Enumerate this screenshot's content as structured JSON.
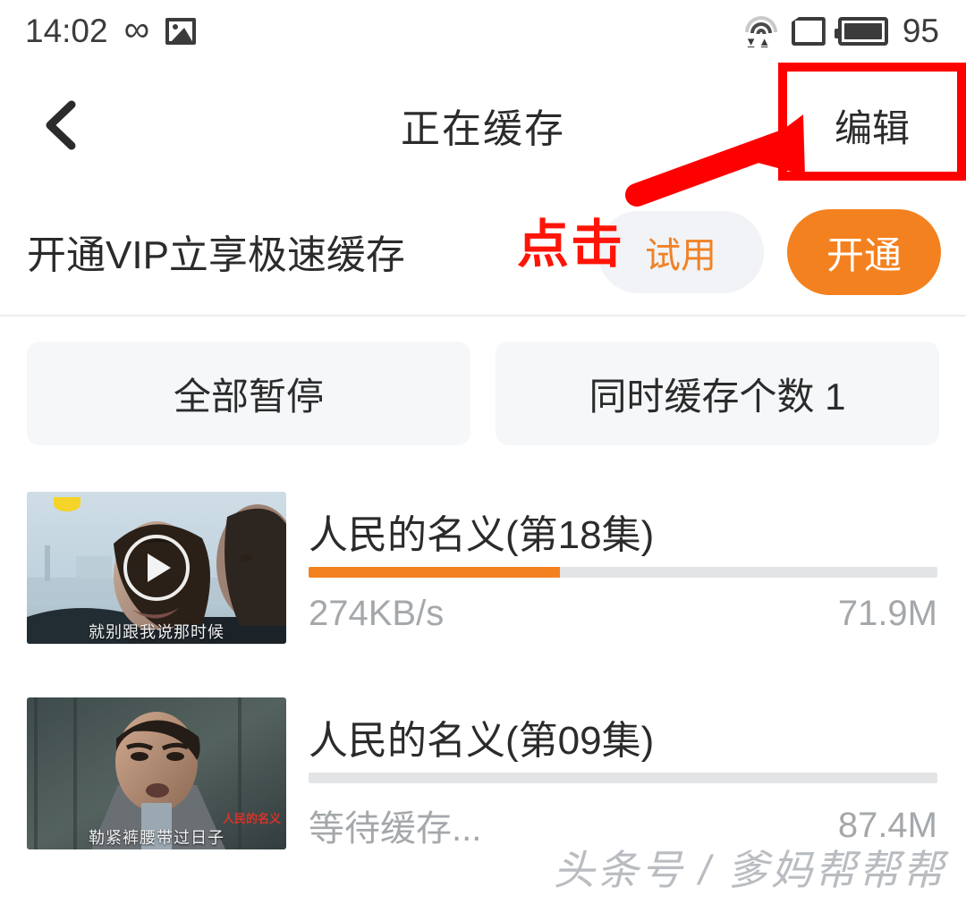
{
  "status_bar": {
    "time": "14:02",
    "infinity_glyph": "∞",
    "icons": [
      "infinity-icon",
      "image-icon",
      "wifi-icon",
      "sim-card-icon",
      "battery-icon"
    ],
    "battery_level": "95"
  },
  "nav": {
    "back_icon": "back-chevron-icon",
    "title": "正在缓存",
    "edit_label": "编辑"
  },
  "vip": {
    "text": "开通VIP立享极速缓存",
    "trial_label": "试用",
    "open_label": "开通"
  },
  "actions": {
    "pause_all_label": "全部暂停",
    "concurrent_label": "同时缓存个数 1"
  },
  "downloads": [
    {
      "title": "人民的名义(第18集)",
      "speed": "274KB/s",
      "size": "71.9M",
      "progress_percent": 40,
      "thumb_subtitle": "就别跟我说那时候",
      "thumb_logo": ""
    },
    {
      "title": "人民的名义(第09集)",
      "speed": "等待缓存...",
      "size": "87.4M",
      "progress_percent": 0,
      "thumb_subtitle": "勒紧裤腰带过日子",
      "thumb_logo": "人民的名义"
    }
  ],
  "annotations": {
    "click_label": "点击",
    "highlight_color": "#FF0000",
    "arrow_color": "#FF0000"
  },
  "watermark": {
    "text": "头条号 / 爹妈帮帮帮"
  },
  "colors": {
    "accent_orange": "#F4811F",
    "trial_bg": "#F1F3F6",
    "button_bg": "#F5F7F9",
    "text_primary": "#2B2B2B",
    "text_muted": "#A5A8AB",
    "annotation_red": "#FF0000"
  }
}
